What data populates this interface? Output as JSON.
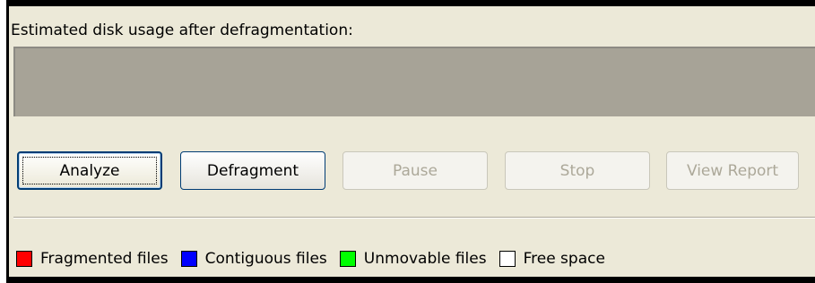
{
  "caption": "Estimated disk usage after defragmentation:",
  "buttons": {
    "analyze": "Analyze",
    "defragment": "Defragment",
    "pause": "Pause",
    "stop": "Stop",
    "view_report": "View Report"
  },
  "legend": [
    {
      "label": "Fragmented files",
      "color": "#ff0000",
      "icon": "red-swatch-icon"
    },
    {
      "label": "Contiguous files",
      "color": "#0000ff",
      "icon": "blue-swatch-icon"
    },
    {
      "label": "Unmovable files",
      "color": "#00ff00",
      "icon": "green-swatch-icon"
    },
    {
      "label": "Free space",
      "color": "#ffffff",
      "icon": "white-swatch-icon"
    }
  ],
  "disk_map_color": "#a7a397"
}
